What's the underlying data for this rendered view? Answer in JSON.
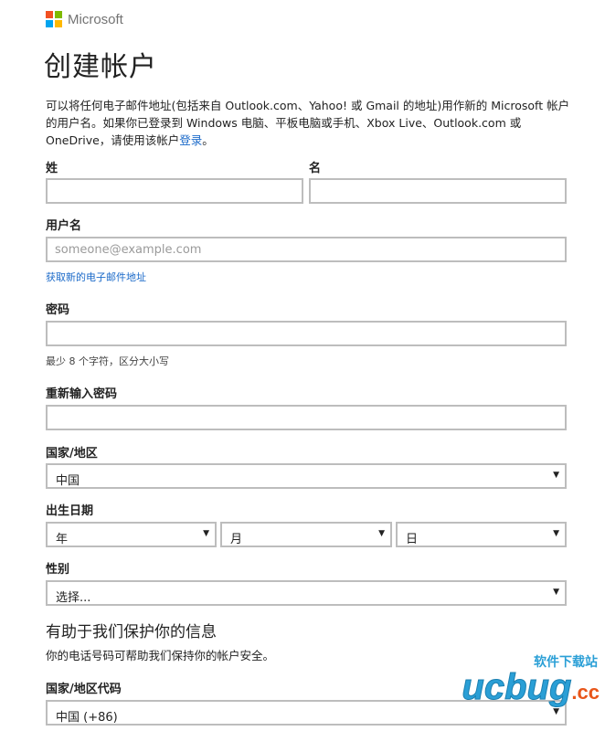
{
  "brand": {
    "name": "Microsoft",
    "logo_colors": [
      "#f25022",
      "#7fba00",
      "#00a4ef",
      "#ffb900"
    ]
  },
  "page": {
    "title": "创建帐户",
    "intro_text": "可以将任何电子邮件地址(包括来自 Outlook.com、Yahoo! 或 Gmail 的地址)用作新的 Microsoft 帐户的用户名。如果你已登录到 Windows 电脑、平板电脑或手机、Xbox Live、Outlook.com 或 OneDrive，请使用该帐户",
    "intro_link": "登录",
    "intro_end": "。"
  },
  "form": {
    "last_name_label": "姓",
    "first_name_label": "名",
    "last_name_value": "",
    "first_name_value": "",
    "username_label": "用户名",
    "username_value": "",
    "username_placeholder": "someone@example.com",
    "new_email_link": "获取新的电子邮件地址",
    "password_label": "密码",
    "password_value": "",
    "password_hint": "最少 8 个字符，区分大小写",
    "reenter_password_label": "重新输入密码",
    "reenter_password_value": "",
    "country_label": "国家/地区",
    "country_value": "中国",
    "birthdate_label": "出生日期",
    "birth_year": "年",
    "birth_month": "月",
    "birth_day": "日",
    "gender_label": "性别",
    "gender_value": "选择...",
    "protect_title": "有助于我们保护你的信息",
    "protect_text": "你的电话号码可帮助我们保持你的帐户安全。",
    "country_code_label": "国家/地区代码",
    "country_code_value": "中国 (+86)"
  },
  "watermark": {
    "site_name": "软件下载站",
    "logo_text": "ucbug",
    "logo_suffix": ".cc",
    "colors": [
      "#2a9fd6",
      "#e8561a",
      "#f0a400"
    ]
  }
}
